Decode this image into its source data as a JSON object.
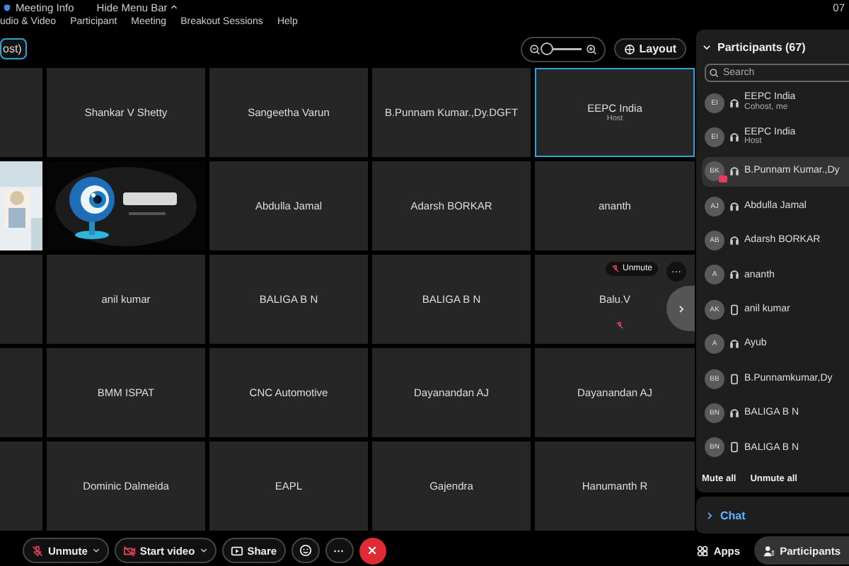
{
  "title_bar": {
    "meeting_info": "Meeting Info",
    "hide_menu": "Hide Menu Bar",
    "right_text": "07"
  },
  "menu": [
    "udio & Video",
    "Participant",
    "Meeting",
    "Breakout Sessions",
    "Help"
  ],
  "toolbar": {
    "cut_button": "ost)",
    "zoom": {
      "level": 0.05
    },
    "layout_button": "Layout"
  },
  "grid": {
    "next_page": true,
    "tiles": [
      {
        "kind": "blank"
      },
      {
        "kind": "name",
        "name": "Shankar V Shetty",
        "selected": false,
        "hovered": false
      },
      {
        "kind": "name",
        "name": "Sangeetha Varun",
        "selected": false,
        "hovered": false
      },
      {
        "kind": "name",
        "name": "B.Punnam Kumar.,Dy.DGFT",
        "selected": false,
        "hovered": false
      },
      {
        "kind": "name",
        "name": "EEPC India",
        "subtitle": "Host",
        "selected": true,
        "hovered": false
      },
      {
        "kind": "picture"
      },
      {
        "kind": "picture"
      },
      {
        "kind": "name",
        "name": "Abdulla Jamal",
        "selected": false,
        "hovered": false
      },
      {
        "kind": "name",
        "name": "Adarsh BORKAR",
        "selected": false,
        "hovered": false
      },
      {
        "kind": "name",
        "name": "ananth",
        "selected": false,
        "hovered": false
      },
      {
        "kind": "blank"
      },
      {
        "kind": "name",
        "name": "anil kumar",
        "selected": false,
        "hovered": false
      },
      {
        "kind": "name",
        "name": "BALIGA B N",
        "selected": false,
        "hovered": false
      },
      {
        "kind": "name",
        "name": "BALIGA B N",
        "selected": false,
        "hovered": false
      },
      {
        "kind": "name",
        "name": "Balu.V",
        "selected": false,
        "hovered": true,
        "unmute_label": "Unmute",
        "more": "···"
      },
      {
        "kind": "blank"
      },
      {
        "kind": "name",
        "name": "BMM ISPAT",
        "selected": false,
        "hovered": false
      },
      {
        "kind": "name",
        "name": "CNC Automotive",
        "selected": false,
        "hovered": false
      },
      {
        "kind": "name",
        "name": "Dayanandan AJ",
        "selected": false,
        "hovered": false
      },
      {
        "kind": "name",
        "name": "Dayanandan AJ",
        "selected": false,
        "hovered": false
      },
      {
        "kind": "blank"
      },
      {
        "kind": "name",
        "name": "Dominic Dalmeida",
        "selected": false,
        "hovered": false
      },
      {
        "kind": "name",
        "name": "EAPL",
        "selected": false,
        "hovered": false
      },
      {
        "kind": "name",
        "name": "Gajendra",
        "selected": false,
        "hovered": false
      },
      {
        "kind": "name",
        "name": "Hanumanth R",
        "selected": false,
        "hovered": false
      }
    ]
  },
  "participants": {
    "title": "Participants (67)",
    "expanded": true,
    "search": {
      "placeholder": "Search"
    },
    "items": [
      {
        "initials": "EI",
        "kind": "headset",
        "name": "EEPC India",
        "subtitle": "Cohost, me",
        "selected": false,
        "alert": false
      },
      {
        "initials": "EI",
        "kind": "headset",
        "name": "EEPC India",
        "subtitle": "Host",
        "selected": false,
        "alert": false
      },
      {
        "initials": "BK",
        "kind": "headset",
        "name": "B.Punnam Kumar.,Dy",
        "selected": true,
        "alert": true
      },
      {
        "initials": "AJ",
        "kind": "headset",
        "name": "Abdulla Jamal",
        "selected": false,
        "alert": false
      },
      {
        "initials": "AB",
        "kind": "headset",
        "name": "Adarsh BORKAR",
        "selected": false,
        "alert": false
      },
      {
        "initials": "A",
        "kind": "headset",
        "name": "ananth",
        "selected": false,
        "alert": false
      },
      {
        "initials": "AK",
        "kind": "phone",
        "name": "anil kumar",
        "selected": false,
        "alert": false
      },
      {
        "initials": "A",
        "kind": "headset",
        "name": "Ayub",
        "selected": false,
        "alert": false
      },
      {
        "initials": "BB",
        "kind": "phone",
        "name": "B.Punnamkumar,Dy",
        "selected": false,
        "alert": false
      },
      {
        "initials": "BN",
        "kind": "headset",
        "name": "BALIGA B N",
        "selected": false,
        "alert": false
      },
      {
        "initials": "BN",
        "kind": "phone",
        "name": "BALIGA B N",
        "selected": false,
        "alert": false
      }
    ],
    "mute_all": "Mute all",
    "unmute_all": "Unmute all"
  },
  "chat": {
    "title": "Chat",
    "expanded": false
  },
  "bottom_bar": {
    "buttons": [
      {
        "kind": "mic",
        "label": "Unmute",
        "caret": true
      },
      {
        "kind": "video",
        "label": "Start video",
        "caret": true
      },
      {
        "kind": "share",
        "label": "Share",
        "caret": false
      },
      {
        "kind": "reactions"
      },
      {
        "kind": "more",
        "label": "···"
      },
      {
        "kind": "end"
      }
    ],
    "right": [
      {
        "kind": "apps",
        "label": "Apps",
        "selected": false
      },
      {
        "kind": "participants",
        "label": "Participants",
        "selected": true
      }
    ]
  }
}
